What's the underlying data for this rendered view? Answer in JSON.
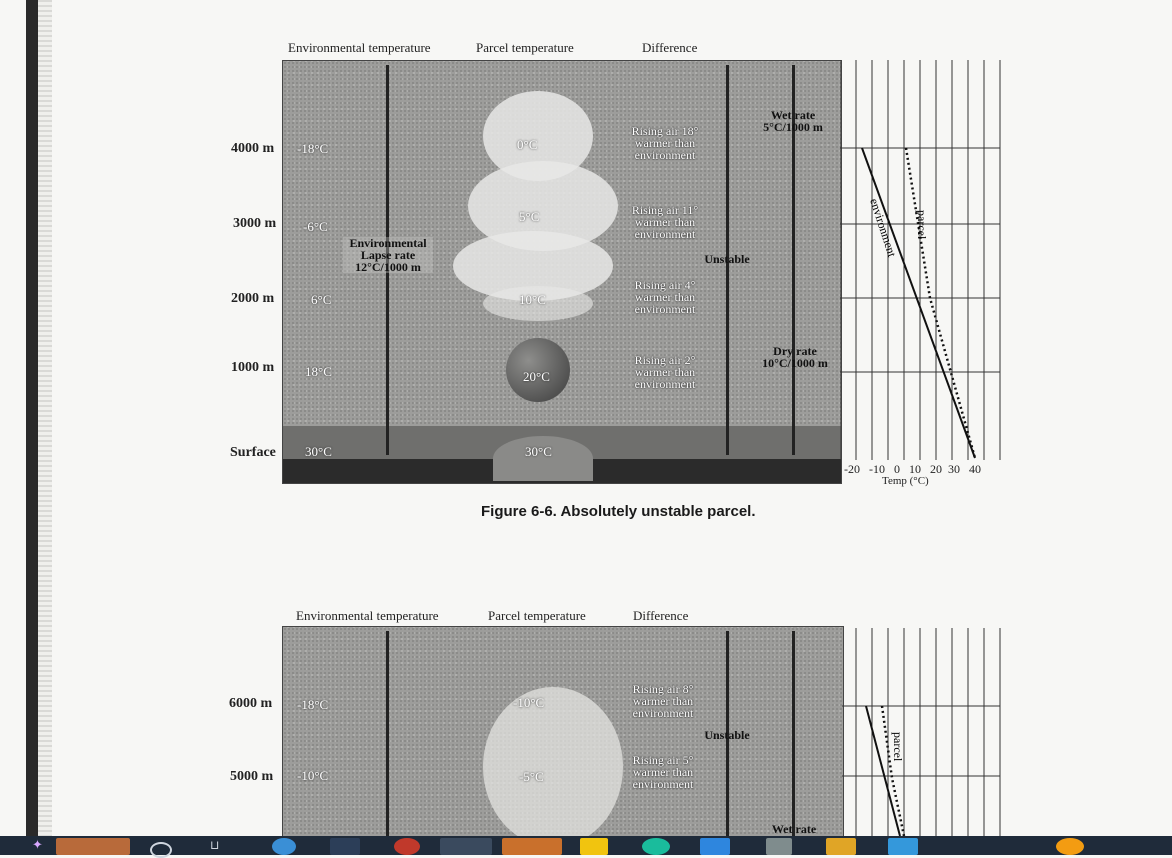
{
  "figure1": {
    "col_env": "Environmental temperature",
    "col_parcel": "Parcel temperature",
    "col_diff": "Difference",
    "altitudes": [
      "4000 m",
      "3000 m",
      "2000 m",
      "1000 m",
      "Surface"
    ],
    "env_temps": [
      "-18°C",
      "-6°C",
      "6°C",
      "18°C",
      "30°C"
    ],
    "parcel_temps": [
      "0°C",
      "5°C",
      "10°C",
      "20°C",
      "30°C"
    ],
    "lapse_label": [
      "Environmental",
      "Lapse rate",
      "12°C/1000 m"
    ],
    "diffs": [
      [
        "Rising air 18°",
        "warmer than",
        "environment"
      ],
      [
        "Rising air 11°",
        "warmer than",
        "environment"
      ],
      [
        "Rising air 4°",
        "warmer than",
        "environment"
      ],
      [
        "Rising air 2°",
        "warmer than",
        "environment"
      ]
    ],
    "wet_rate": [
      "Wet rate",
      "5°C/1000 m"
    ],
    "dry_rate": [
      "Dry rate",
      "10°C/1000 m"
    ],
    "unstable": "Unstable",
    "caption": "Figure 6-6. Absolutely unstable parcel.",
    "chart_env_label": "environment",
    "chart_parcel_label": "parcel",
    "chart_ticks": [
      "-20",
      "-10",
      "0",
      "10",
      "20",
      "30",
      "40"
    ],
    "chart_xlabel": "Temp (°C)"
  },
  "figure2": {
    "col_env": "Environmental temperature",
    "col_parcel": "Parcel temperature",
    "col_diff": "Difference",
    "altitudes": [
      "6000 m",
      "5000 m"
    ],
    "env_temps": [
      "-18°C",
      "-10°C"
    ],
    "parcel_temps": [
      "-10°C",
      "-5°C"
    ],
    "diffs": [
      [
        "Rising air 8°",
        "warmer than",
        "environment"
      ],
      [
        "Rising air 5°",
        "warmer than",
        "environment"
      ]
    ],
    "unstable": "Unstable",
    "wet_rate": "Wet rate",
    "chart_parcel_label": "parcel"
  }
}
